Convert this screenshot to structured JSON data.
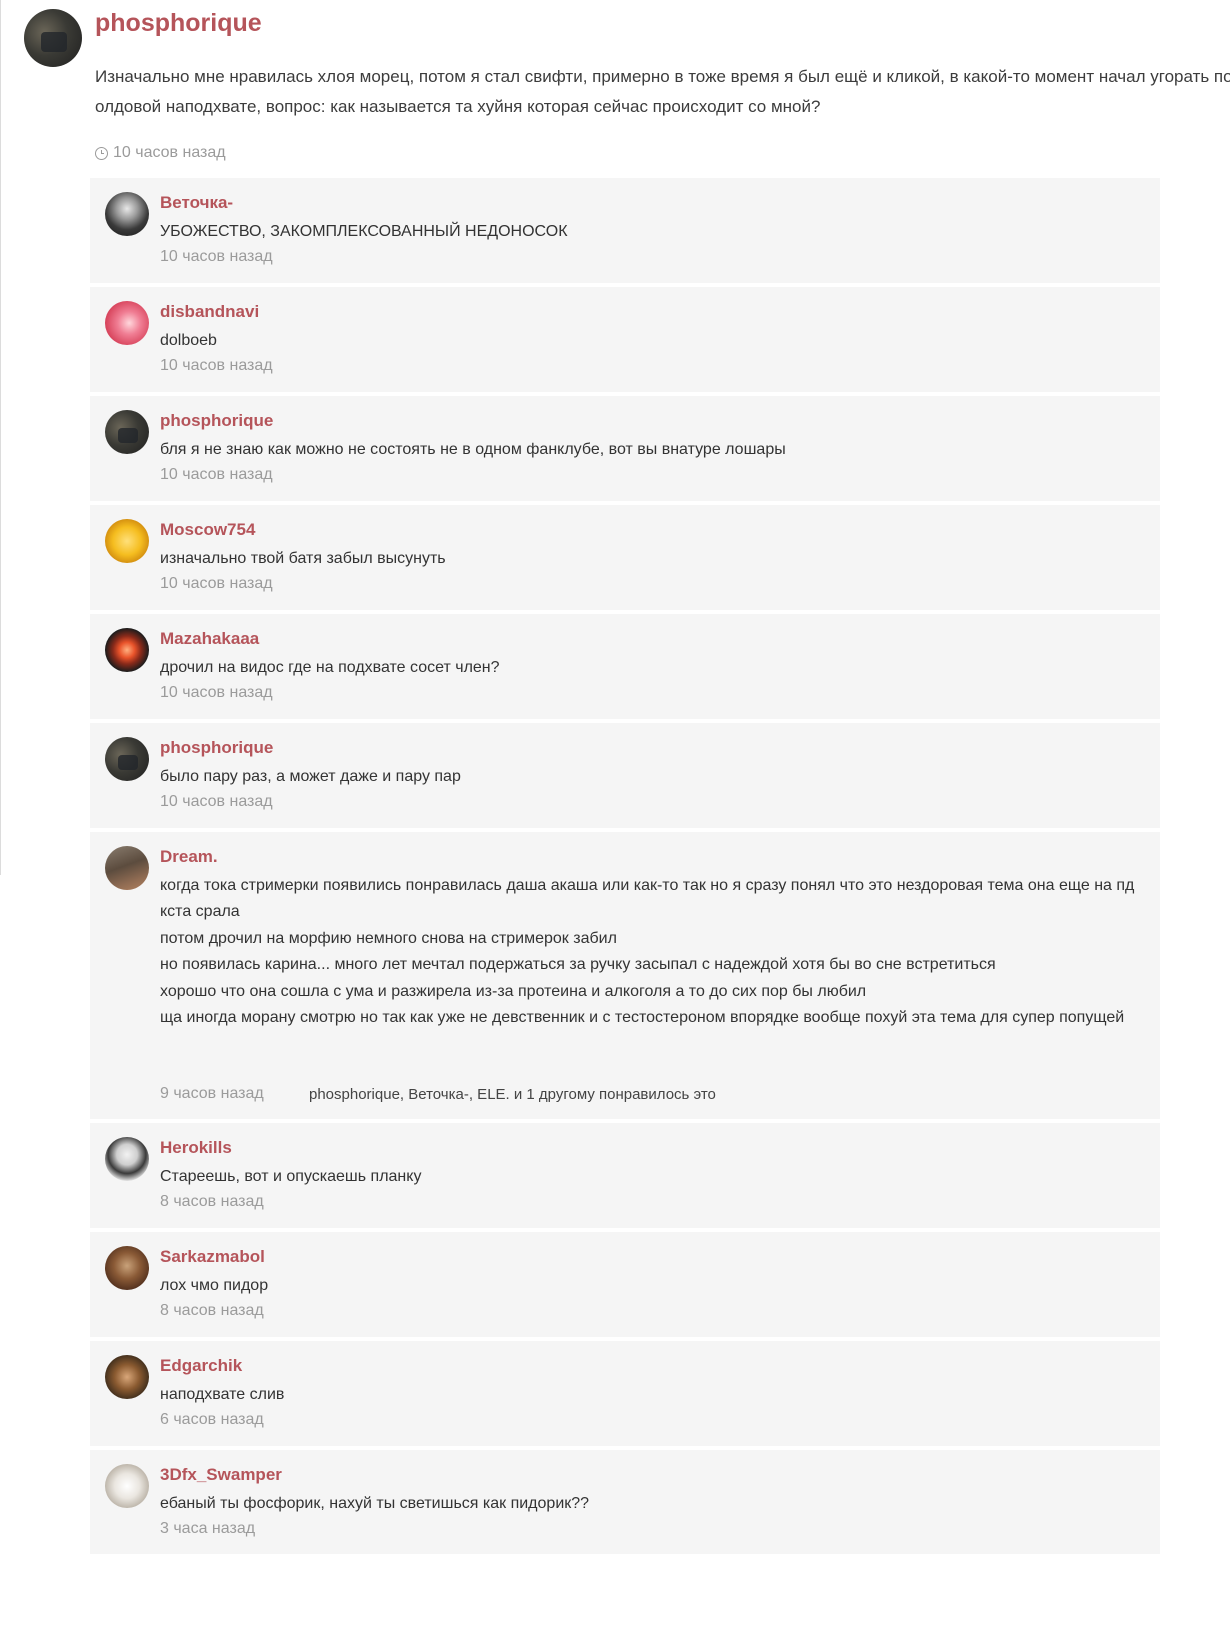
{
  "post": {
    "author": "phosphorique",
    "text": "Изначально мне нравилась хлоя морец, потом я стал свифти, примерно в тоже время я был ещё и кликой, в какой-то момент начал угорать по олдовой наподхвате, вопрос: как называется та хуйня которая сейчас происходит со мной?",
    "time": "10 часов назад",
    "time_icon": "clock-icon"
  },
  "colors": {
    "accent": "#b5545a",
    "comment_bg": "#f5f5f5",
    "muted_text": "#9b9b9b"
  },
  "comments": [
    {
      "author": "Веточка-",
      "text": "УБОЖЕСТВО, ЗАКОМПЛЕКСОВАННЫЙ НЕДОНОСОК",
      "time": "10 часов назад"
    },
    {
      "author": "disbandnavi",
      "text": "dolboeb",
      "time": "10 часов назад"
    },
    {
      "author": "phosphorique",
      "text": "бля я не знаю как можно не состоять не в одном фанклубе, вот вы внатуре лошары",
      "time": "10 часов назад"
    },
    {
      "author": "Moscow754",
      "text": "изначально твой батя забыл высунуть",
      "time": "10 часов назад"
    },
    {
      "author": "Mazahakaaa",
      "text": "дрочил на видос где на подхвате сосет член?",
      "time": "10 часов назад"
    },
    {
      "author": "phosphorique",
      "text": "было пару раз, а может даже и пару пар",
      "time": "10 часов назад"
    },
    {
      "author": "Dream.",
      "lines": [
        "когда тока стримерки появились понравилась даша акаша или как-то так но я сразу понял что это нездоровая тема она еще на пд кста срала",
        "потом дрочил на морфию немного снова на стримерок забил",
        "но появилась карина... много лет мечтал подержаться за ручку засыпал с надеждой хотя бы во сне встретиться",
        "хорошо что она сошла с ума и разжирела из-за протеина и алкоголя а то до сих пор бы любил",
        "ща иногда морану смотрю но так как уже не девственник и с тестостероном впорядке вообще  похуй эта тема для супер попущей"
      ],
      "time": "9 часов назад",
      "likes": "phosphorique, Веточка-, ELE. и 1 другому понравилось это"
    },
    {
      "author": "Herokills",
      "text": "Стареешь, вот и опускаешь планку",
      "time": "8 часов назад"
    },
    {
      "author": "Sarkazmabol",
      "text": "лох чмо пидор",
      "time": "8 часов назад"
    },
    {
      "author": "Edgarchik",
      "text": "наподхвате слив",
      "time": "6 часов назад"
    },
    {
      "author": "3Dfx_Swamper",
      "text": "ебаный ты фосфорик, нахуй ты светишься как пидорик??",
      "time": "3 часа назад"
    }
  ]
}
